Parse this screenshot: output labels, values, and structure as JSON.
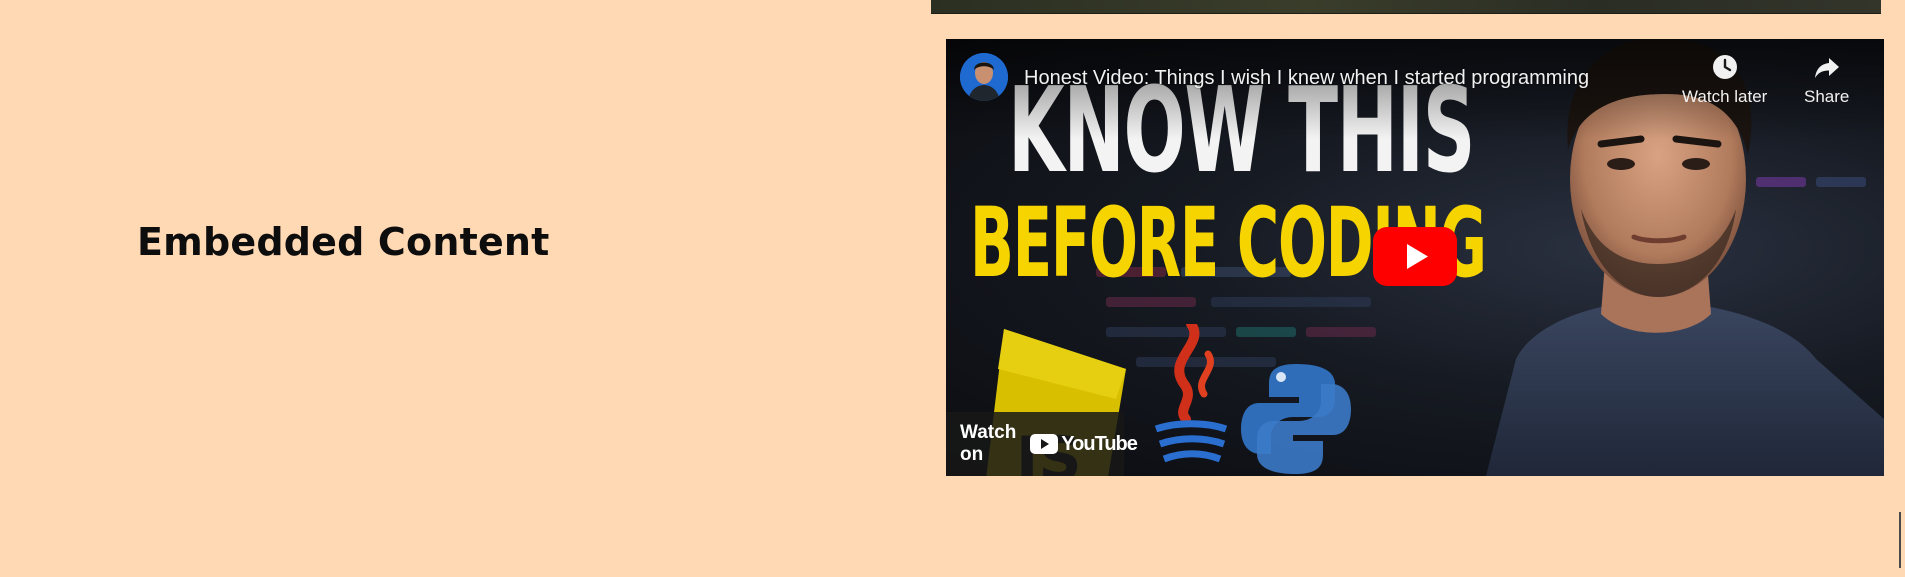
{
  "section": {
    "title": "Embedded Content"
  },
  "video": {
    "title": "Honest Video: Things I wish I knew when I started programming",
    "thumbnail_headline_1": "KNOW THIS",
    "thumbnail_headline_2": "BEFORE CODING",
    "actions": {
      "watch_later_label": "Watch later",
      "share_label": "Share"
    },
    "watch_on_label": "Watch on",
    "platform_wordmark": "YouTube",
    "icons": {
      "avatar": "channel-avatar",
      "watch_later": "clock-icon",
      "share": "share-arrow-icon",
      "play": "play-button-icon",
      "logo": "youtube-logo-icon"
    }
  },
  "colors": {
    "page_background": "#ffd8b4",
    "headline_white": "#f3f3f3",
    "headline_yellow": "#f6d400",
    "play_red": "#ff0000"
  }
}
